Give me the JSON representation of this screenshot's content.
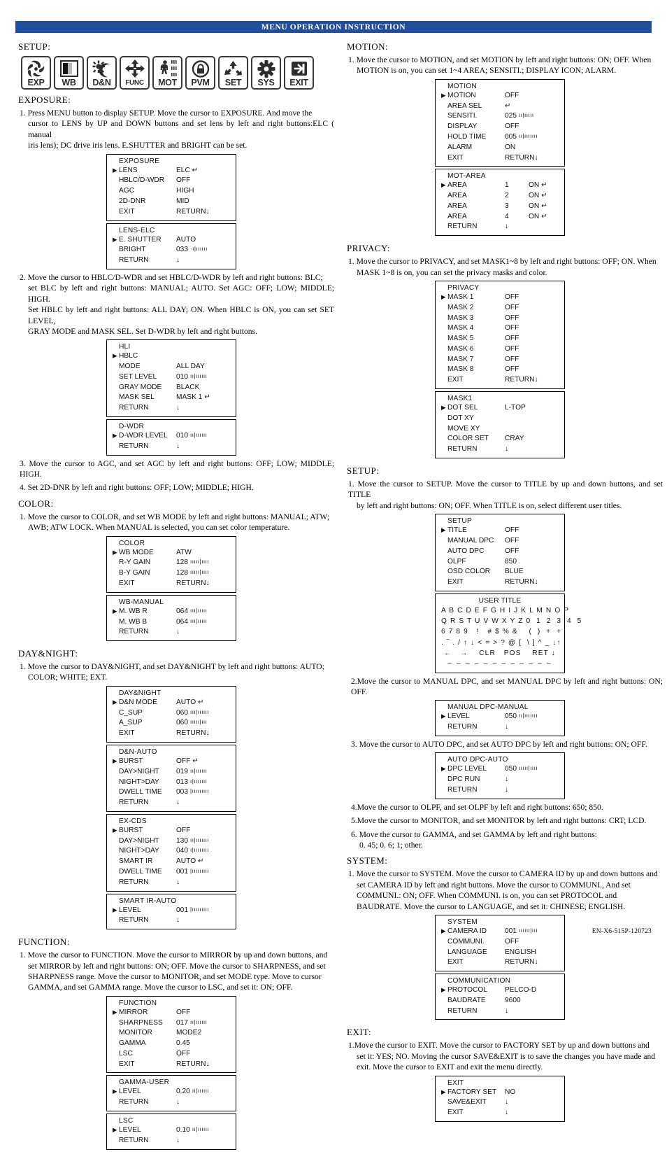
{
  "header": {
    "title": "MENU OPERATION INSTRUCTION"
  },
  "footer": {
    "code": "EN-X6-515P-120723"
  },
  "left": {
    "setup_heading": "SETUP:",
    "icons": [
      {
        "name": "exp-icon",
        "label": "EXP"
      },
      {
        "name": "wb-icon",
        "label": "WB"
      },
      {
        "name": "dn-icon",
        "label": "D&N"
      },
      {
        "name": "func-icon",
        "label": "FUNC"
      },
      {
        "name": "mot-icon",
        "label": "MOT"
      },
      {
        "name": "pvm-icon",
        "label": "PVM"
      },
      {
        "name": "set-icon",
        "label": "SET"
      },
      {
        "name": "sys-icon",
        "label": "SYS"
      },
      {
        "name": "exit-icon",
        "label": "EXIT"
      }
    ],
    "exposure_heading": "EXPOSURE:",
    "exposure_p1_a": "1. Press  MENU button to display SETUP. Move the cursor to EXPOSURE.  And move  the",
    "exposure_p1_b": "cursor  to  LENS  by UP  and DOWN  buttons and set lens by left and right buttons:ELC ( manual",
    "exposure_p1_c": "iris lens); DC drive iris lens. E.SHUTTER and BRIGHT can be set.",
    "exposure_p2_a": "2. Move the cursor to HBLC/D-WDR and set HBLC/D-WDR by left and right buttons: BLC;",
    "exposure_p2_b": "set BLC by left and right buttons: MANUAL; AUTO. Set AGC: OFF; LOW; MIDDLE; HIGH.",
    "exposure_p2_c": " Set HBLC by left and right buttons: ALL DAY; ON. When HBLC is ON, you can set SET LEVEL,",
    "exposure_p2_d": "GRAY MODE and MASK SEL. Set D-WDR by left and right buttons.",
    "exposure_p3": "3. Move the cursor to AGC, and set AGC by left and right buttons: OFF; LOW; MIDDLE; HIGH.",
    "exposure_p4": "4. Set 2D-DNR by left and right buttons: OFF; LOW; MIDDLE; HIGH.",
    "color_heading": "COLOR:",
    "color_p1_a": "1. Move the cursor to COLOR, and set WB MODE by left and right buttons: MANUAL; ATW;",
    "color_p1_b": "AWB; ATW LOCK. When MANUAL is selected, you can set color temperature.",
    "daynight_heading": "DAY&NIGHT:",
    "daynight_p1_a": "1. Move the cursor to DAY&NIGHT, and set DAY&NIGHT by left and right buttons: AUTO;",
    "daynight_p1_b": "COLOR; WHITE; EXT.",
    "function_heading": "FUNCTION:",
    "function_p1_a": "1. Move the cursor to FUNCTION. Move the cursor to MIRROR by up and down buttons, and",
    "function_p1_b": "set MIRROR by left and right buttons: ON; OFF.   Move the cursor to SHARPNESS, and set",
    "function_p1_c": "SHARPNESS range.   Move the cursor to MONITOR, and set MODE type. Move to cursor",
    "function_p1_d": "GAMMA, and set GAMMA range. Move the cursor to LSC, and set it: ON; OFF."
  },
  "right": {
    "motion_heading": "MOTION:",
    "motion_p1_a": "1. Move the cursor to MOTION, and set MOTION by left and right buttons: ON; OFF. When",
    "motion_p1_b": "MOTION is on, you can set 1~4 AREA; SENSITI.; DISPLAY ICON; ALARM.",
    "privacy_heading": "PRIVACY:",
    "privacy_p1_a": "1. Move the cursor to PRIVACY, and set MASK1~8 by left and right buttons: OFF; ON. When",
    "privacy_p1_b": "MASK 1~8 is on, you can set the privacy masks and color.",
    "setup_heading": "SETUP:",
    "setup_p1_a": "1. Move the cursor to SETUP. Move the cursor to TITLE by up and down buttons, and set TITLE",
    "setup_p1_b": "by left and right buttons: ON; OFF. When TITLE is on, select different user titles.",
    "setup_p2": "2.Move the cursor to MANUAL DPC, and set MANUAL DPC by left and right buttons: ON; OFF.",
    "setup_p3": " 3. Move the cursor to AUTO DPC, and set AUTO DPC by left and right buttons: ON; OFF.",
    "setup_p4": "4.Move the cursor to OLPF, and set OLPF by left and right buttons: 650; 850.",
    "setup_p5": "5.Move the cursor to MONITOR, and set MONITOR by left and right buttons: CRT; LCD.",
    "setup_p6_a": "6. Move  the  cursor  to  GAMMA,   and  set  GAMMA  by  left  and  right  buttons:",
    "setup_p6_b": "0. 45;  0. 6;  1; other.",
    "system_heading": "SYSTEM:",
    "system_p1_a": "1. Move the cursor to SYSTEM. Move the cursor to CAMERA ID by up and down buttons and",
    "system_p1_b": "set CAMERA ID by left and right buttons.  Move the cursor to COMMUNI., And set",
    "system_p1_c": "COMMUNI.: ON; OFF. When COMMUNI. is on, you can set PROTOCOL and",
    "system_p1_d": "BAUDRATE.   Move the cursor to LANGUAGE, and set it: CHINESE; ENGLISH.",
    "exit_heading": "EXIT:",
    "exit_p1_a": "1.Move the cursor to EXIT. Move the cursor to FACTORY SET by up and down buttons and",
    "exit_p1_b": "set it: YES; NO.  Moving the cursor SAVE&EXIT is to save the changes you have made and",
    "exit_p1_c": "exit.  Move the cursor to EXIT and exit the menu directly."
  },
  "menus": {
    "exposure": {
      "title": "EXPOSURE",
      "rows": [
        {
          "cursor": true,
          "label": "LENS",
          "value": "ELC",
          "enter": true
        },
        {
          "cursor": false,
          "label": "HBLC/D-WDR",
          "value": "OFF"
        },
        {
          "cursor": false,
          "label": "AGC",
          "value": "HIGH"
        },
        {
          "cursor": false,
          "label": "2D-DNR",
          "value": "MID"
        },
        {
          "cursor": false,
          "label": "EXIT",
          "value": "RETURN",
          "down": true
        }
      ]
    },
    "lens_elc": {
      "title": "LENS-ELC",
      "rows": [
        {
          "cursor": true,
          "label": "E. SHUTTER",
          "value": "AUTO"
        },
        {
          "cursor": false,
          "label": "BRIGHT",
          "value": "033",
          "bar": "·ı|ıııııı"
        },
        {
          "cursor": false,
          "label": "RETURN",
          "value": "",
          "down": true
        }
      ]
    },
    "hli": {
      "title": "HLI",
      "rows": [
        {
          "cursor": true,
          "label": "HBLC",
          "value": ""
        },
        {
          "cursor": false,
          "label": "MODE",
          "value": "ALL DAY"
        },
        {
          "cursor": false,
          "label": "SET LEVEL",
          "value": "010",
          "bar": "ıı|ıııııı"
        },
        {
          "cursor": false,
          "label": "GRAY MODE",
          "value": "BLACK"
        },
        {
          "cursor": false,
          "label": "MASK SEL",
          "value": "MASK 1",
          "enter": true
        },
        {
          "cursor": false,
          "label": "RETURN",
          "value": "",
          "down": true
        }
      ]
    },
    "dwdr": {
      "title": "D-WDR",
      "rows": [
        {
          "cursor": true,
          "label": "D-WDR LEVEL",
          "value": "010",
          "bar": "ıı|ıııııı"
        },
        {
          "cursor": false,
          "label": "RETURN",
          "value": "",
          "down": true
        }
      ]
    },
    "color": {
      "title": "COLOR",
      "rows": [
        {
          "cursor": true,
          "label": "WB MODE",
          "value": "ATW"
        },
        {
          "cursor": false,
          "label": "R-Y GAIN",
          "value": "128",
          "bar": "ııııı|ıııı"
        },
        {
          "cursor": false,
          "label": "B-Y GAIN",
          "value": "128",
          "bar": "ııııı|ıııı"
        },
        {
          "cursor": false,
          "label": "EXIT",
          "value": "RETURN",
          "down": true
        }
      ]
    },
    "wb_manual": {
      "title": "WB-MANUAL",
      "rows": [
        {
          "cursor": true,
          "label": "M. WB R",
          "value": "064",
          "bar": "ııı|ııııı"
        },
        {
          "cursor": false,
          "label": "M. WB B",
          "value": "064",
          "bar": "ııı|ııııı"
        },
        {
          "cursor": false,
          "label": "RETURN",
          "value": "",
          "down": true
        }
      ]
    },
    "daynight": {
      "title": "DAY&NIGHT",
      "rows": [
        {
          "cursor": true,
          "label": "D&N MODE",
          "value": "AUTO",
          "enter": true
        },
        {
          "cursor": false,
          "label": "C_SUP",
          "value": "060",
          "bar": "ııı|ıııııı"
        },
        {
          "cursor": false,
          "label": "A_SUP",
          "value": "060",
          "bar": "ııııı|ııı"
        },
        {
          "cursor": false,
          "label": "EXIT",
          "value": "RETURN",
          "down": true
        }
      ]
    },
    "dn_auto": {
      "title": "D&N-AUTO",
      "rows": [
        {
          "cursor": true,
          "label": "BURST",
          "value": "OFF",
          "enter": true
        },
        {
          "cursor": false,
          "label": "DAY>NIGHT",
          "value": "019",
          "bar": "ıı|ıııııı"
        },
        {
          "cursor": false,
          "label": "NIGHT>DAY",
          "value": "013",
          "bar": "ı|ııııııı"
        },
        {
          "cursor": false,
          "label": "DWELL TIME",
          "value": "003",
          "bar": "|ııııııııı"
        },
        {
          "cursor": false,
          "label": "RETURN",
          "value": "",
          "down": true
        }
      ]
    },
    "ex_cds": {
      "title": "EX-CDS",
      "rows": [
        {
          "cursor": true,
          "label": "BURST",
          "value": "OFF"
        },
        {
          "cursor": false,
          "label": "DAY>NIGHT",
          "value": "130",
          "bar": "ıı|ııııııı"
        },
        {
          "cursor": false,
          "label": "NIGHT>DAY",
          "value": "040",
          "bar": "ı|ıııııııı"
        },
        {
          "cursor": false,
          "label": "SMART IR",
          "value": "AUTO",
          "enter": true
        },
        {
          "cursor": false,
          "label": "DWELL TIME",
          "value": "001",
          "bar": "|ııııııııı"
        },
        {
          "cursor": false,
          "label": "RETURN",
          "value": "",
          "down": true
        }
      ]
    },
    "smart_ir_auto": {
      "title": "SMART IR-AUTO",
      "rows": [
        {
          "cursor": true,
          "label": "LEVEL",
          "value": "001",
          "bar": "|ııııııııı"
        },
        {
          "cursor": false,
          "label": "RETURN",
          "value": "",
          "down": true
        }
      ]
    },
    "function": {
      "title": "FUNCTION",
      "rows": [
        {
          "cursor": true,
          "label": "MIRROR",
          "value": "OFF"
        },
        {
          "cursor": false,
          "label": "SHARPNESS",
          "value": "017",
          "bar": "ıı|ıııııı"
        },
        {
          "cursor": false,
          "label": "MONITOR",
          "value": "MODE2"
        },
        {
          "cursor": false,
          "label": "GAMMA",
          "value": "0.45"
        },
        {
          "cursor": false,
          "label": "LSC",
          "value": "OFF"
        },
        {
          "cursor": false,
          "label": "EXIT",
          "value": "RETURN",
          "down": true
        }
      ]
    },
    "gamma_user": {
      "title": "GAMMA-USER",
      "rows": [
        {
          "cursor": true,
          "label": "LEVEL",
          "value": "0.20",
          "bar": "ıı|ıııııı"
        },
        {
          "cursor": false,
          "label": "RETURN",
          "value": "",
          "down": true
        }
      ]
    },
    "lsc": {
      "title": "LSC",
      "rows": [
        {
          "cursor": true,
          "label": "LEVEL",
          "value": "0.10",
          "bar": "ıı|ıııııı"
        },
        {
          "cursor": false,
          "label": "RETURN",
          "value": "",
          "down": true
        }
      ]
    },
    "motion": {
      "title": "MOTION",
      "rows": [
        {
          "cursor": true,
          "label": "MOTION",
          "value": "OFF"
        },
        {
          "cursor": false,
          "label": "AREA SEL",
          "value": "",
          "enter": true
        },
        {
          "cursor": false,
          "label": "SENSITI.",
          "value": "025",
          "bar": "ıı|ııııı"
        },
        {
          "cursor": false,
          "label": "DISPLAY",
          "value": "OFF"
        },
        {
          "cursor": false,
          "label": "HOLD TIME",
          "value": "005",
          "bar": "ıı|ııııııı"
        },
        {
          "cursor": false,
          "label": "ALARM",
          "value": "ON"
        },
        {
          "cursor": false,
          "label": "EXIT",
          "value": "RETURN",
          "down": true
        }
      ]
    },
    "mot_area": {
      "title": "MOT-AREA",
      "rows": [
        {
          "cursor": true,
          "label": "AREA",
          "num": "1",
          "value": "ON",
          "enter": true
        },
        {
          "cursor": false,
          "label": "AREA",
          "num": "2",
          "value": "ON",
          "enter": true
        },
        {
          "cursor": false,
          "label": "AREA",
          "num": "3",
          "value": "ON",
          "enter": true
        },
        {
          "cursor": false,
          "label": "AREA",
          "num": "4",
          "value": "ON",
          "enter": true
        },
        {
          "cursor": false,
          "label": "RETURN",
          "value": "",
          "down": true
        }
      ]
    },
    "privacy": {
      "title": "PRIVACY",
      "rows": [
        {
          "cursor": true,
          "label": "MASK 1",
          "value": "OFF"
        },
        {
          "cursor": false,
          "label": "MASK 2",
          "value": "OFF"
        },
        {
          "cursor": false,
          "label": "MASK 3",
          "value": "OFF"
        },
        {
          "cursor": false,
          "label": "MASK 4",
          "value": "OFF"
        },
        {
          "cursor": false,
          "label": "MASK 5",
          "value": "OFF"
        },
        {
          "cursor": false,
          "label": "MASK 6",
          "value": "OFF"
        },
        {
          "cursor": false,
          "label": "MASK 7",
          "value": "OFF"
        },
        {
          "cursor": false,
          "label": "MASK 8",
          "value": "OFF"
        },
        {
          "cursor": false,
          "label": "EXIT",
          "value": "RETURN",
          "down": true
        }
      ]
    },
    "mask1": {
      "title": "MASK1",
      "rows": [
        {
          "cursor": true,
          "label": "DOT   SEL",
          "value": "L-TOP"
        },
        {
          "cursor": false,
          "label": "DOT   XY",
          "value": ""
        },
        {
          "cursor": false,
          "label": "MOVE  XY",
          "value": ""
        },
        {
          "cursor": false,
          "label": "COLOR SET",
          "value": "CRAY"
        },
        {
          "cursor": false,
          "label": "RETURN",
          "value": "",
          "down": true
        }
      ]
    },
    "setup": {
      "title": "SETUP",
      "rows": [
        {
          "cursor": true,
          "label": "TITLE",
          "value": "OFF"
        },
        {
          "cursor": false,
          "label": "MANUAL DPC",
          "value": "OFF"
        },
        {
          "cursor": false,
          "label": "AUTO DPC",
          "value": "OFF"
        },
        {
          "cursor": false,
          "label": "OLPF",
          "value": "850"
        },
        {
          "cursor": false,
          "label": "OSD COLOR",
          "value": "BLUE"
        },
        {
          "cursor": false,
          "label": "EXIT",
          "value": "RETURN",
          "down": true
        }
      ]
    },
    "user_title": {
      "title": "USER TITLE",
      "lines": [
        "A B C D E F G H I J K L M N O P",
        "Q R S T U V W X Y Z 0  1  2  3  4  5",
        "6 7 8 9   !   # $ % &    (  )  +  +",
        ". ‾ . / ↑ ↓ < = > ? @ [  \\ ] ^ _ ↓↑",
        "←   →    CLR   POS    RET ↓",
        "– – – – – – – – – – – –"
      ]
    },
    "manual_dpc": {
      "title": "MANUAL DPC-MANUAL",
      "rows": [
        {
          "cursor": true,
          "label": "LEVEL",
          "value": "050",
          "bar": "ıı|ııııııı"
        },
        {
          "cursor": false,
          "label": "RETURN",
          "value": "",
          "down": true
        }
      ]
    },
    "auto_dpc": {
      "title": "AUTO DPC-AUTO",
      "rows": [
        {
          "cursor": true,
          "label": "DPC LEVEL",
          "value": "050",
          "bar": "ııııı|ıııı"
        },
        {
          "cursor": false,
          "label": "DPC RUN",
          "value": "",
          "down": true
        },
        {
          "cursor": false,
          "label": "RETURN",
          "value": "",
          "down": true
        }
      ]
    },
    "system": {
      "title": "SYSTEM",
      "rows": [
        {
          "cursor": true,
          "label": "CAMERA ID",
          "value": "001",
          "bar": "ıııııı|ııı"
        },
        {
          "cursor": false,
          "label": "COMMUNI.",
          "value": "OFF"
        },
        {
          "cursor": false,
          "label": "LANGUAGE",
          "value": "ENGLISH"
        },
        {
          "cursor": false,
          "label": "EXIT",
          "value": "RETURN",
          "down": true
        }
      ]
    },
    "communication": {
      "title": "COMMUNICATION",
      "rows": [
        {
          "cursor": true,
          "label": "PROTOCOL",
          "value": "PELCO-D"
        },
        {
          "cursor": false,
          "label": "BAUDRATE",
          "value": "9600"
        },
        {
          "cursor": false,
          "label": "RETURN",
          "value": "",
          "down": true
        }
      ]
    },
    "exit": {
      "title": "EXIT",
      "rows": [
        {
          "cursor": true,
          "label": "FACTORY SET",
          "value": "NO"
        },
        {
          "cursor": false,
          "label": "SAVE&EXIT",
          "value": "",
          "down": true
        },
        {
          "cursor": false,
          "label": "EXIT",
          "value": "",
          "down": true
        }
      ]
    }
  }
}
